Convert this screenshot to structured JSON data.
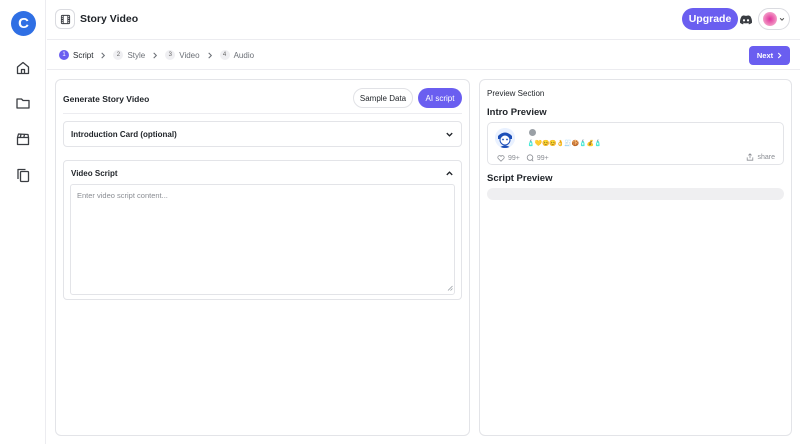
{
  "app": {
    "logo_letter": "C",
    "page_title": "Story Video"
  },
  "header": {
    "upgrade_label": "Upgrade"
  },
  "steps": [
    {
      "num": "1",
      "label": "Script",
      "active": true
    },
    {
      "num": "2",
      "label": "Style",
      "active": false
    },
    {
      "num": "3",
      "label": "Video",
      "active": false
    },
    {
      "num": "4",
      "label": "Audio",
      "active": false
    }
  ],
  "stepsbar": {
    "next_label": "Next"
  },
  "generate": {
    "title": "Generate Story Video",
    "sample_label": "Sample Data",
    "ai_label": "AI script",
    "intro_card_label": "Introduction Card (optional)",
    "video_script_label": "Video Script",
    "script_placeholder": "Enter video script content..."
  },
  "preview": {
    "section_label": "Preview Section",
    "intro_title": "Intro Preview",
    "emojis": "🧴💛😊😊👌🧾🍪🧴💰🧴",
    "likes": "99+",
    "comments": "99+",
    "share_label": "share",
    "script_title": "Script Preview"
  },
  "colors": {
    "accent": "#6a5ef0",
    "logo": "#2f6fe4"
  }
}
